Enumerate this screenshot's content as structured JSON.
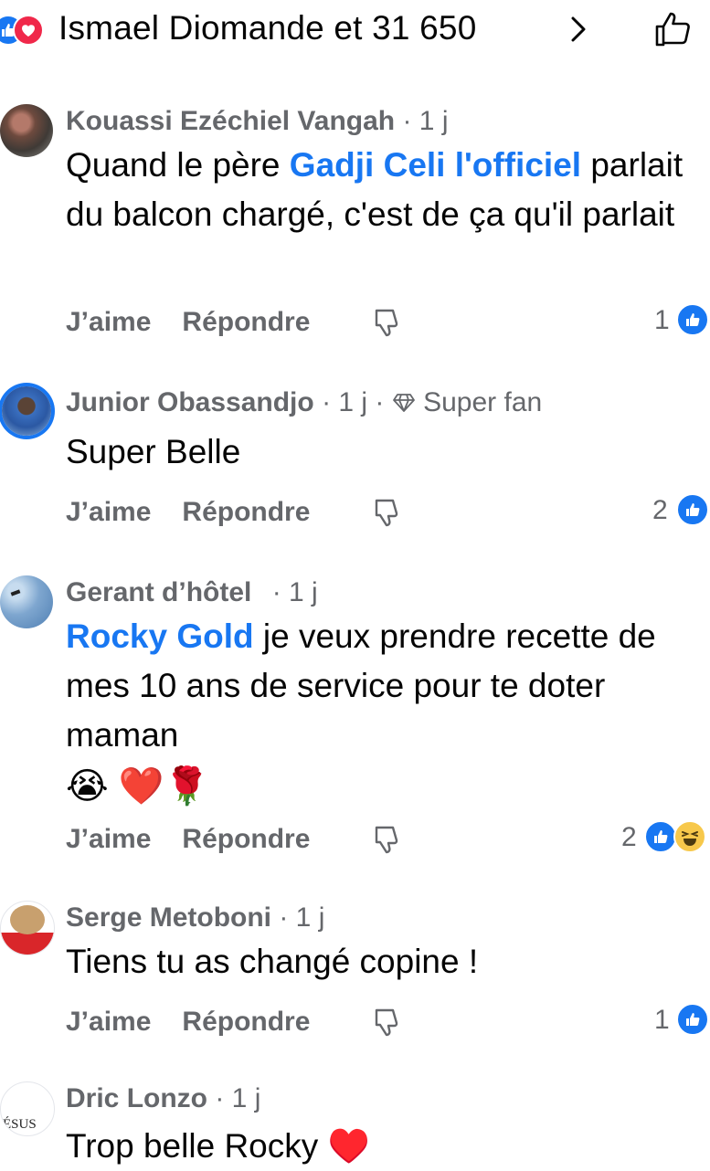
{
  "header": {
    "reactors_text": "Ismael Diomande et 31 650",
    "colors": {
      "like": "#1877F2",
      "love": "#F0284A"
    }
  },
  "comments": [
    {
      "name": "Kouassi Ezéchiel Vangah",
      "time": "· 1 j",
      "mention": "Gadji Celi l'officiel",
      "text_before": "Quand le père ",
      "text_after": " parlait du balcon chargé, c'est de ça qu'il parlait",
      "like_label": "J’aime",
      "reply_label": "Répondre",
      "reaction_count": "1"
    },
    {
      "name": "Junior Obassandjo",
      "time": "· 1 j ·",
      "badge": "Super fan",
      "text": "Super Belle",
      "like_label": "J’aime",
      "reply_label": "Répondre",
      "reaction_count": "2"
    },
    {
      "name": "Gerant d’hôtel",
      "time": "· 1 j",
      "mention": "Rocky Gold",
      "text_after": " je veux prendre recette de mes 10 ans de service pour te doter maman ",
      "emoji_line": "😭 ❤️🌹",
      "like_label": "J’aime",
      "reply_label": "Répondre",
      "reaction_count": "2"
    },
    {
      "name": "Serge Metoboni",
      "time": "· 1 j",
      "text": "Tiens tu as changé copine !",
      "like_label": "J’aime",
      "reply_label": "Répondre",
      "reaction_count": "1"
    },
    {
      "name": "Dric Lonzo",
      "time": "· 1 j",
      "text": "Trop belle Rocky ♥️",
      "avatar_text": "ÉSUS"
    }
  ]
}
